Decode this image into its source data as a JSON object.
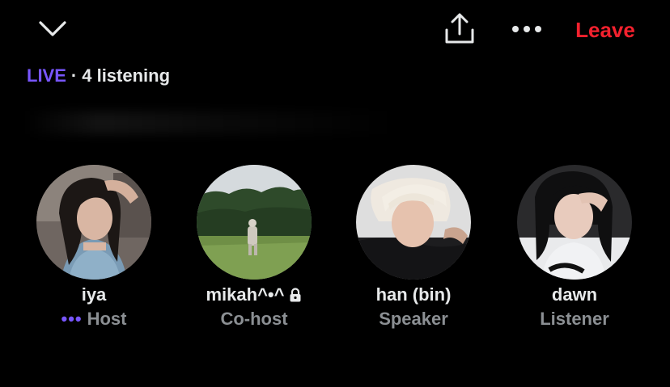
{
  "theme": {
    "background": "#000000",
    "live_color": "#7856ff",
    "leave_color": "#f4212e",
    "text_color": "#e7e9ea",
    "muted_color": "#8b8f93"
  },
  "topbar": {
    "collapse_icon": "chevron-down-icon",
    "share_icon": "share-icon",
    "more_icon": "more-dots-icon",
    "leave_label": "Leave"
  },
  "status": {
    "live_label": "LIVE",
    "separator": "·",
    "listening_text": "4 listening"
  },
  "participants": [
    {
      "name": "iya",
      "role": "Host",
      "speaking_indicator": "•••",
      "avatar_icon": "user-avatar"
    },
    {
      "name": "mikah^•^",
      "role": "Co-host",
      "locked": true,
      "avatar_icon": "user-avatar"
    },
    {
      "name": "han (bin)",
      "role": "Speaker",
      "avatar_icon": "user-avatar"
    },
    {
      "name": "dawn",
      "role": "Listener",
      "avatar_icon": "user-avatar"
    }
  ]
}
